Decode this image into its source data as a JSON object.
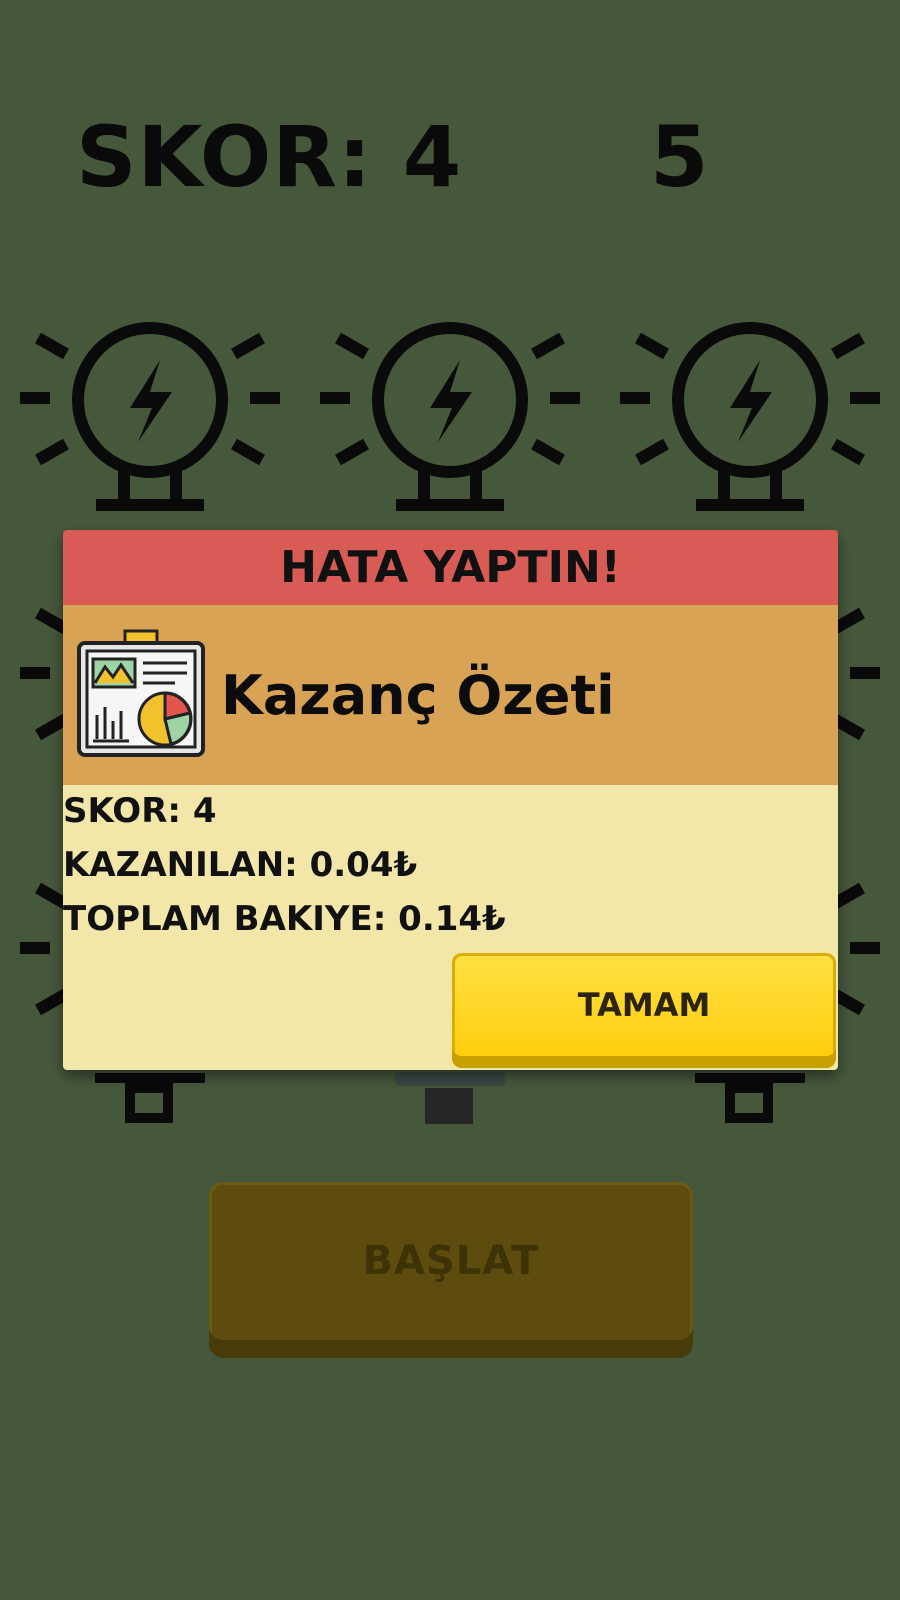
{
  "hud": {
    "score_text": "SKOR: 4",
    "level_text": "5"
  },
  "modal": {
    "header": "HATA YAPTIN!",
    "subtitle": "Kazanç Özeti",
    "stats": [
      "SKOR: 4",
      "KAZANILAN: 0.04₺",
      "TOPLAM BAKIYE: 0.14₺"
    ],
    "ok_label": "TAMAM"
  },
  "start_label": "BAŞLAT",
  "colors": {
    "background": "#46583c",
    "modal_header": "#d95b55",
    "modal_subheader": "#d8a355",
    "modal_body": "#f2e6a9",
    "ok_button": "#ffd21a",
    "start_button": "#5e4c0e"
  },
  "icons": {
    "bulb": "lightbulb-bolt-icon",
    "summary": "dashboard-chart-icon"
  }
}
